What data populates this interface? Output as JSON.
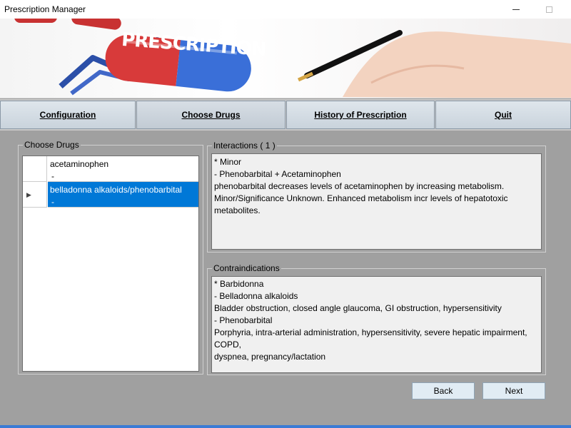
{
  "window": {
    "title": "Prescription Manager"
  },
  "banner": {
    "pill_text": "PRESCRIPTION"
  },
  "tabs": [
    {
      "label": "Configuration"
    },
    {
      "label": "Choose Drugs"
    },
    {
      "label": "History of Prescription"
    },
    {
      "label": "Quit"
    }
  ],
  "choose_drugs": {
    "legend": "Choose Drugs",
    "rows": [
      {
        "name": "acetaminophen",
        "detail": "-"
      },
      {
        "name": "belladonna alkaloids/phenobarbital",
        "detail": "-",
        "selected": true
      }
    ]
  },
  "interactions": {
    "legend": "Interactions ( 1 )",
    "lines": [
      "* Minor",
      "- Phenobarbital + Acetaminophen",
      "phenobarbital decreases levels of acetaminophen by increasing metabolism.",
      "Minor/Significance Unknown. Enhanced metabolism incr levels of hepatotoxic metabolites."
    ]
  },
  "contraindications": {
    "legend": "Contraindications",
    "lines": [
      "* Barbidonna",
      "- Belladonna alkaloids",
      "Bladder obstruction, closed angle glaucoma, GI obstruction, hypersensitivity",
      "- Phenobarbital",
      "Porphyria, intra-arterial administration, hypersensitivity, severe hepatic impairment, COPD,",
      "dyspnea, pregnancy/lactation"
    ]
  },
  "buttons": {
    "back": "Back",
    "next": "Next"
  },
  "colors": {
    "selection": "#0078d7",
    "background": "#a0a0a0",
    "pill_red": "#d83a3a",
    "pill_blue": "#3a6fd8"
  }
}
